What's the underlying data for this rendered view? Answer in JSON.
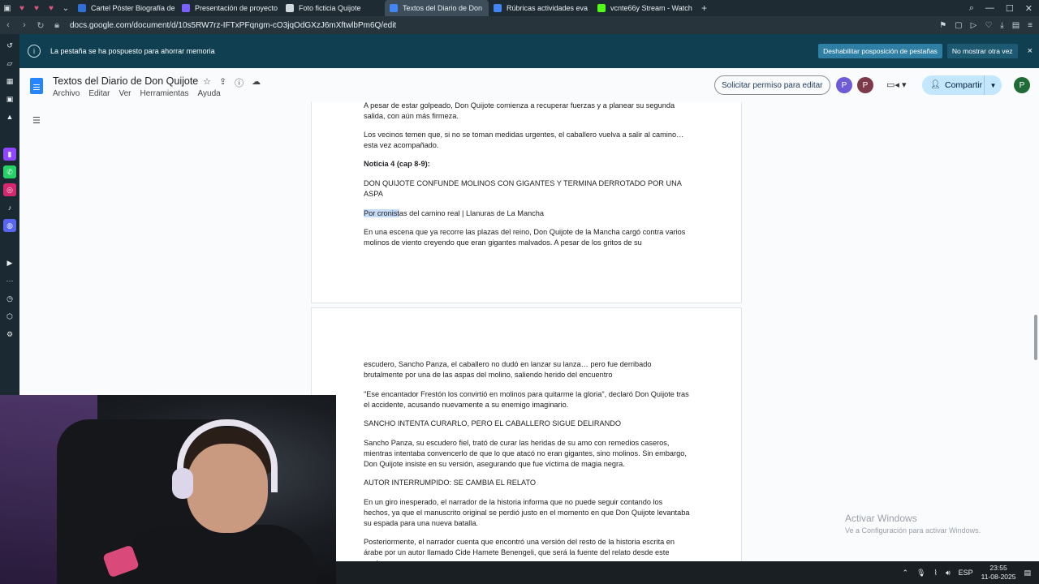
{
  "browser": {
    "tabs": [
      {
        "label": "Cartel Póster Biografía de",
        "color": "#2f6fd6",
        "active": false
      },
      {
        "label": "Presentación de proyecto",
        "color": "#7b61ff",
        "active": false
      },
      {
        "label": "Foto ficticia Quijote",
        "color": "#cfd8dc",
        "active": false
      },
      {
        "label": "Textos del Diario de Don",
        "color": "#4285f4",
        "active": true
      },
      {
        "label": "Rúbricas actividades eva",
        "color": "#4285f4",
        "active": false
      },
      {
        "label": "vcnte66y Stream - Watch",
        "color": "#53fc18",
        "active": false
      }
    ],
    "new_tab": "+",
    "url": "docs.google.com/document/d/10s5RW7rz-IFTxPFqngm-cO3jqOdGXzJ6mXftwlbPm6Q/edit"
  },
  "notice": {
    "text": "La pestaña se ha pospuesto para ahorrar memoria",
    "disable_label": "Deshabilitar posposición de pestañas",
    "never_label": "No mostrar otra vez",
    "close": "×"
  },
  "docs": {
    "title": "Textos del Diario de Don Quijote",
    "menu": [
      "Archivo",
      "Editar",
      "Ver",
      "Herramientas",
      "Ayuda"
    ],
    "request_edit": "Solicitar permiso para editar",
    "avatars": [
      {
        "letter": "P",
        "color": "#6f5ad8"
      },
      {
        "letter": "P",
        "color": "#7d3a4a"
      }
    ],
    "share": "Compartir",
    "profile": {
      "letter": "P",
      "color": "#1e6b37"
    }
  },
  "page1": {
    "p1": "A pesar de estar golpeado, Don Quijote comienza a recuperar fuerzas y a planear su segunda salida, con aún más firmeza.",
    "p2": "Los vecinos temen que, si no se toman medidas urgentes, el caballero vuelva a salir al camino… esta vez acompañado.",
    "p3": "Noticia 4 (cap 8-9):",
    "p4": "DON QUIJOTE CONFUNDE MOLINOS CON GIGANTES Y TERMINA DERROTADO POR UNA ASPA",
    "p5_selected": "Por cronist",
    "p5_rest": "as del camino real | Llanuras de La Mancha",
    "p6": "En una escena que ya recorre las plazas del reino, Don Quijote de la Mancha cargó contra varios molinos de viento creyendo que eran gigantes malvados. A pesar de los gritos de su"
  },
  "page2": {
    "p1": "escudero, Sancho Panza, el caballero no dudó en lanzar su lanza… pero fue derribado brutalmente por una de las aspas del molino, saliendo herido del encuentro",
    "p2": "\"Ese encantador Frestón los convirtió en molinos para quitarme la gloria\", declaró Don Quijote tras el accidente, acusando nuevamente a su enemigo imaginario.",
    "p3": "SANCHO INTENTA CURARLO, PERO EL CABALLERO SIGUE DELIRANDO",
    "p4": "Sancho Panza, su escudero fiel, trató de curar las heridas de su amo con remedios caseros, mientras intentaba convencerlo de que lo que atacó no eran gigantes, sino molinos. Sin embargo, Don Quijote insiste en su versión, asegurando que fue víctima de magia negra.",
    "p5": "AUTOR INTERRUMPIDO: SE CAMBIA EL RELATO",
    "p6": "En un giro inesperado, el narrador de la historia informa que no puede seguir contando los hechos, ya que el manuscrito original se perdió justo en el momento en que Don Quijote levantaba su espada para una nueva batalla.",
    "p7": "Posteriormente, el narrador cuenta que encontró una versión del resto de la historia escrita en árabe por un autor llamado Cide Hamete Benengeli, que será la fuente del relato desde este punto."
  },
  "watermark": {
    "title": "Activar Windows",
    "subtitle": "Ve a Configuración para activar Windows."
  },
  "taskbar": {
    "lang": "ESP",
    "time": "23:55",
    "date": "11-08-2025"
  }
}
